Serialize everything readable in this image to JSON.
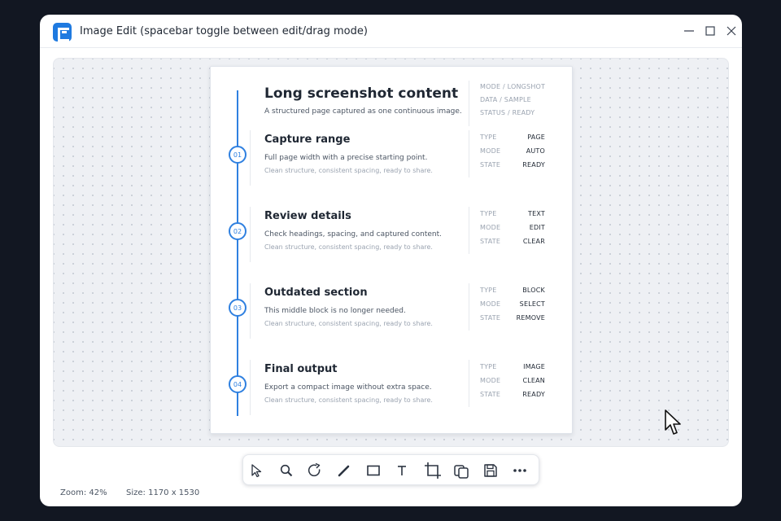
{
  "window": {
    "title": "Image Edit (spacebar toggle between edit/drag mode)",
    "accent": "#1f7ae0"
  },
  "sheet": {
    "title": "Long screenshot content",
    "subtitle": "A structured page captured as one continuous image.",
    "meta": [
      "MODE / LONGSHOT",
      "DATA / SAMPLE",
      "STATUS / READY"
    ],
    "steps": [
      {
        "num": "01",
        "title": "Capture range",
        "desc": "Full page width with a precise starting point.",
        "note": "Clean structure, consistent spacing, ready to share.",
        "kv": [
          {
            "k": "TYPE",
            "v": "PAGE"
          },
          {
            "k": "MODE",
            "v": "AUTO"
          },
          {
            "k": "STATE",
            "v": "READY"
          }
        ]
      },
      {
        "num": "02",
        "title": "Review details",
        "desc": "Check headings, spacing, and captured content.",
        "note": "Clean structure, consistent spacing, ready to share.",
        "kv": [
          {
            "k": "TYPE",
            "v": "TEXT"
          },
          {
            "k": "MODE",
            "v": "EDIT"
          },
          {
            "k": "STATE",
            "v": "CLEAR"
          }
        ]
      },
      {
        "num": "03",
        "title": "Outdated section",
        "desc": "This middle block is no longer needed.",
        "note": "Clean structure, consistent spacing, ready to share.",
        "kv": [
          {
            "k": "TYPE",
            "v": "BLOCK"
          },
          {
            "k": "MODE",
            "v": "SELECT"
          },
          {
            "k": "STATE",
            "v": "REMOVE"
          }
        ]
      },
      {
        "num": "04",
        "title": "Final output",
        "desc": "Export a compact image without extra space.",
        "note": "Clean structure, consistent spacing, ready to share.",
        "kv": [
          {
            "k": "TYPE",
            "v": "IMAGE"
          },
          {
            "k": "MODE",
            "v": "CLEAN"
          },
          {
            "k": "STATE",
            "v": "READY"
          }
        ]
      }
    ]
  },
  "toolbar": {
    "tools": [
      "select-icon",
      "zoom-icon",
      "rotate-icon",
      "pen-icon",
      "rectangle-icon",
      "text-icon",
      "crop-icon",
      "copy-icon",
      "save-icon",
      "more-icon"
    ]
  },
  "status": {
    "zoom": "Zoom: 42%",
    "size": "Size: 1170 x 1530"
  }
}
